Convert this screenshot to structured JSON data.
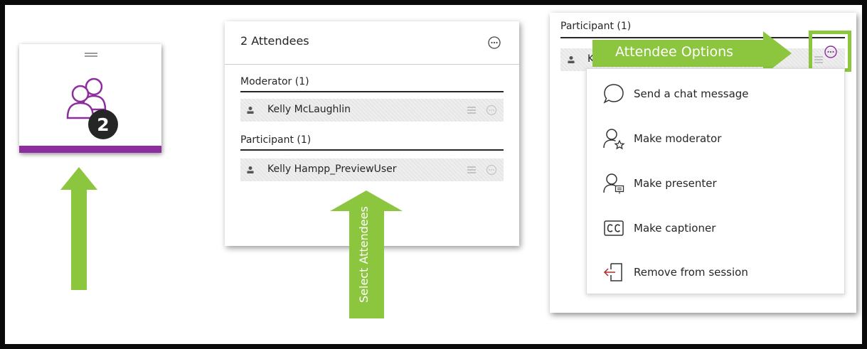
{
  "tile": {
    "badge_count": "2",
    "accent_color": "#8e2d9e"
  },
  "attendees_panel": {
    "title": "2 Attendees",
    "groups": [
      {
        "label": "Moderator (1)",
        "attendees": [
          "Kelly McLaughlin"
        ]
      },
      {
        "label": "Participant (1)",
        "attendees": [
          "Kelly Hampp_PreviewUser"
        ]
      }
    ]
  },
  "annotations": {
    "select_attendees": "Select Attendees",
    "attendee_options": "Attendee Options",
    "arrow_color": "#8cc63f"
  },
  "options_panel": {
    "group_label": "Participant (1)",
    "row_initial": "K",
    "menu": [
      {
        "label": "Send a chat message",
        "icon": "chat-bubble-icon"
      },
      {
        "label": "Make moderator",
        "icon": "person-star-icon"
      },
      {
        "label": "Make presenter",
        "icon": "person-screen-icon"
      },
      {
        "label": "Make captioner",
        "icon": "cc-icon"
      },
      {
        "label": "Remove from session",
        "icon": "exit-arrow-icon"
      }
    ]
  }
}
